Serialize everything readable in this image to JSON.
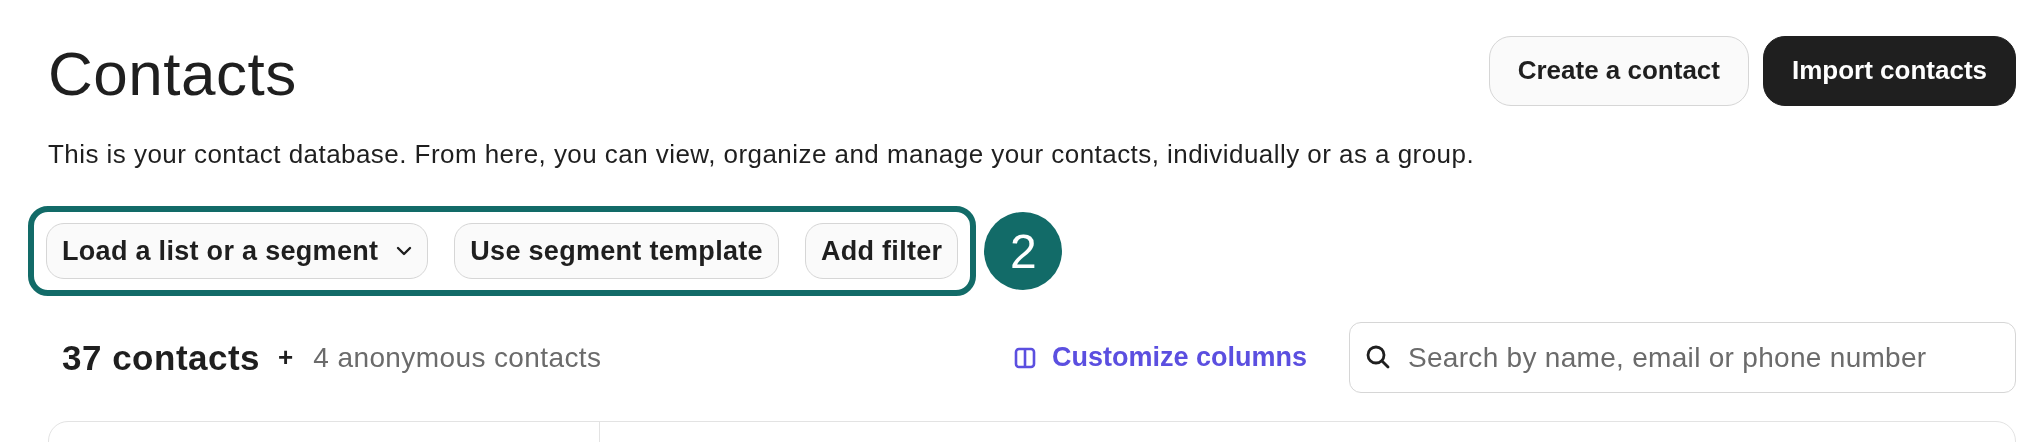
{
  "header": {
    "title": "Contacts",
    "buttons": [
      {
        "label": "Create a contact",
        "kind": "secondary"
      },
      {
        "label": "Import contacts",
        "kind": "primary"
      }
    ]
  },
  "description": "This is your contact database. From here, you can view, organize and manage your contacts, individually or as a group.",
  "filters": [
    {
      "label": "Load a list or a segment",
      "kind": "dropdown"
    },
    {
      "label": "Use segment template",
      "kind": "plain"
    },
    {
      "label": "Add filter",
      "kind": "plain"
    }
  ],
  "callout": {
    "number": "2"
  },
  "summary": {
    "count": "37 contacts",
    "plus": "+",
    "anonymous": "4 anonymous contacts"
  },
  "customize": {
    "label": "Customize columns"
  },
  "search": {
    "placeholder": "Search by name, email or phone number"
  }
}
